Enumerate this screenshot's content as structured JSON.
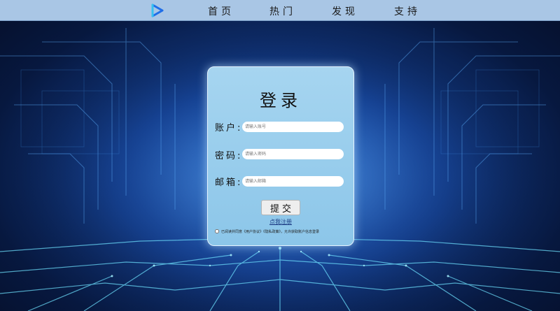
{
  "nav": {
    "items": [
      "首页",
      "热门",
      "发现",
      "支持"
    ]
  },
  "login": {
    "title": "登录",
    "account_label": "账户:",
    "account_placeholder": "请输入账号",
    "password_label": "密码:",
    "password_placeholder": "请输入密码",
    "email_label": "邮箱:",
    "email_placeholder": "请输入邮箱",
    "submit_label": "提交",
    "register_link": "点我注册",
    "agreement_text": "已阅读并同意《用户协议》《隐私政策》，允许获取账户信息登录"
  },
  "colors": {
    "navbar": "#a9c6e5",
    "card": "#a6d5f0",
    "background": "#123a86",
    "accent": "#1f3f86"
  }
}
